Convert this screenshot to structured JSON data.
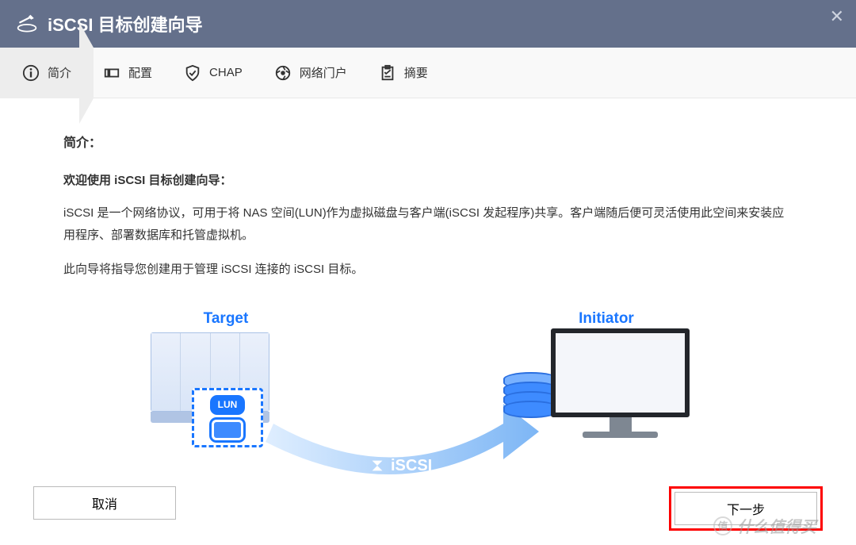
{
  "titlebar": {
    "title": "iSCSI 目标创建向导"
  },
  "steps": {
    "s1": "简介",
    "s2": "配置",
    "s3": "CHAP",
    "s4": "网络门户",
    "s5": "摘要"
  },
  "content": {
    "heading": "简介：",
    "subheading": "欢迎使用 iSCSI 目标创建向导：",
    "p1": "iSCSI 是一个网络协议，可用于将 NAS 空间(LUN)作为虚拟磁盘与客户端(iSCSI 发起程序)共享。客户端随后便可灵活使用此空间来安装应用程序、部署数据库和托管虚拟机。",
    "p2": "此向导将指导您创建用于管理 iSCSI 连接的 iSCSI 目标。"
  },
  "diagram": {
    "target": "Target",
    "initiator": "Initiator",
    "lun": "LUN",
    "protocol": "iSCSI"
  },
  "footer": {
    "cancel": "取消",
    "next": "下一步"
  },
  "watermark": {
    "text": "什么值得买"
  }
}
